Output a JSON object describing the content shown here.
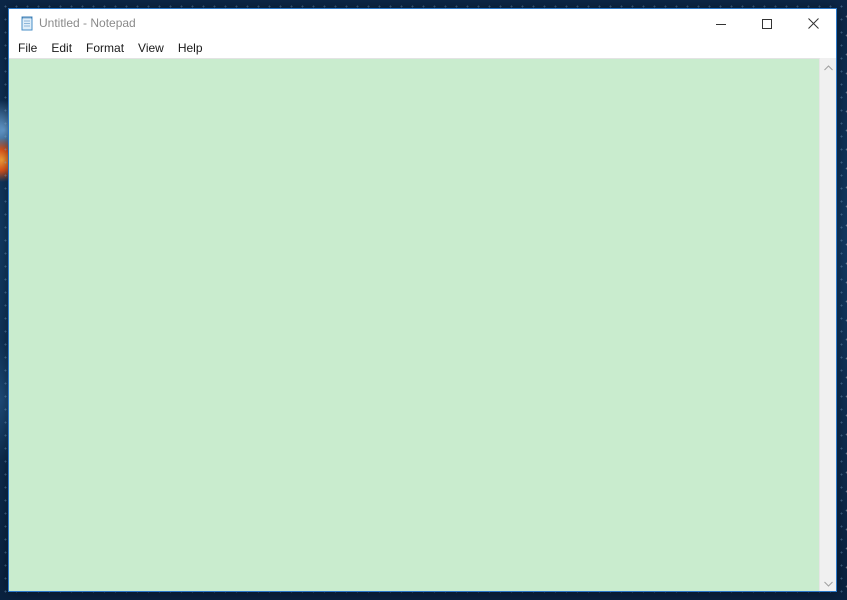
{
  "window": {
    "title": "Untitled - Notepad",
    "icon": "notepad-icon"
  },
  "caption_buttons": {
    "minimize_icon": "minimize-icon",
    "maximize_icon": "maximize-icon",
    "close_icon": "close-icon"
  },
  "menu": {
    "items": [
      {
        "label": "File"
      },
      {
        "label": "Edit"
      },
      {
        "label": "Format"
      },
      {
        "label": "View"
      },
      {
        "label": "Help"
      }
    ]
  },
  "editor": {
    "value": "",
    "background_color": "#c9ecce"
  },
  "scrollbar": {
    "up_icon": "chevron-up-icon",
    "down_icon": "chevron-down-icon"
  },
  "colors": {
    "window_border": "#2b78c8",
    "title_text": "#8a8a8a"
  }
}
